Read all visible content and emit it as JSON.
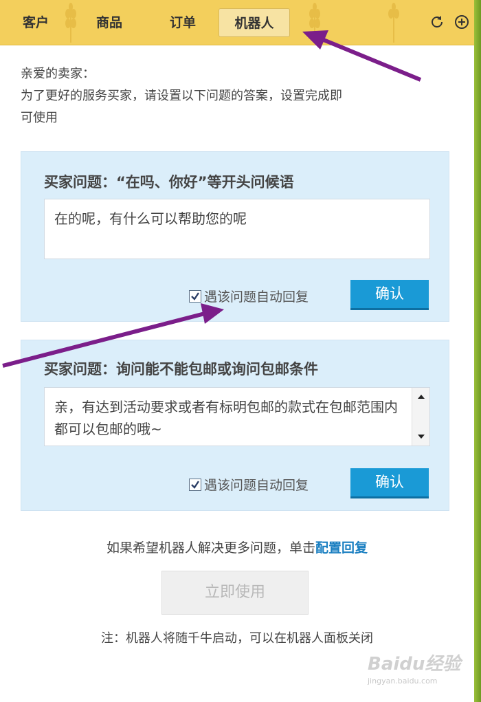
{
  "tabs": [
    {
      "label": "客户"
    },
    {
      "label": "商品"
    },
    {
      "label": "订单"
    },
    {
      "label": "机器人",
      "active": true
    }
  ],
  "toolbar": {
    "refresh_icon": "refresh-icon",
    "add_icon": "add-icon"
  },
  "greeting": {
    "line1": "亲爱的卖家：",
    "line2": "为了更好的服务买家，请设置以下问题的答案，设置完成即",
    "line3": "可使用"
  },
  "questions": [
    {
      "title": "买家问题：“在吗、你好”等开头问候语",
      "answer": "在的呢，有什么可以帮助您的呢",
      "auto_reply_label": "遇该问题自动回复",
      "auto_reply_checked": true,
      "confirm_label": "确认"
    },
    {
      "title": "买家问题：询问能不能包邮或询问包邮条件",
      "answer": "亲，有达到活动要求或者有标明包邮的款式在包邮范围内都可以包邮的哦~",
      "auto_reply_label": "遇该问题自动回复",
      "auto_reply_checked": true,
      "confirm_label": "确认"
    }
  ],
  "more": {
    "text": "如果希望机器人解决更多问题，单击",
    "link": "配置回复"
  },
  "use_button": "立即使用",
  "note": "注：机器人将随千牛启动，可以在机器人面板关闭",
  "watermark": {
    "logo": "Baidu经验",
    "url": "jingyan.baidu.com"
  },
  "colors": {
    "topbar": "#f3cf5c",
    "card": "#dbeefa",
    "button": "#1a9ad6",
    "link": "#1a7fc1",
    "arrow": "#7b1e8a"
  }
}
